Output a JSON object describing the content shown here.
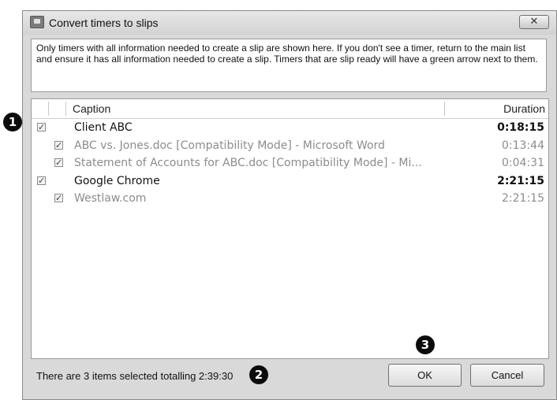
{
  "window": {
    "title": "Convert timers to slips",
    "close_glyph": "✕"
  },
  "info_text": "Only timers with all information needed to create a slip are shown here. If you don't see  a timer, return to the main list and ensure it has all information needed to create a slip. Timers that are slip ready will have a green arrow next to them.",
  "columns": {
    "caption": "Caption",
    "duration": "Duration"
  },
  "rows": [
    {
      "caption": "Client ABC",
      "duration": "0:18:15",
      "checked": true,
      "level": 0
    },
    {
      "caption": "ABC vs. Jones.doc [Compatibility Mode] - Microsoft Word",
      "duration": "0:13:44",
      "checked": true,
      "level": 1
    },
    {
      "caption": "Statement of Accounts for ABC.doc [Compatibility Mode] - Mi...",
      "duration": "0:04:31",
      "checked": true,
      "level": 1
    },
    {
      "caption": "Google Chrome",
      "duration": "2:21:15",
      "checked": true,
      "level": 0
    },
    {
      "caption": "Westlaw.com",
      "duration": "2:21:15",
      "checked": true,
      "level": 1
    }
  ],
  "status_text": "There are 3 items selected totalling 2:39:30",
  "buttons": {
    "ok": "OK",
    "cancel": "Cancel"
  },
  "callouts": {
    "one": "1",
    "two": "2",
    "three": "3"
  },
  "check_glyph": "✓"
}
